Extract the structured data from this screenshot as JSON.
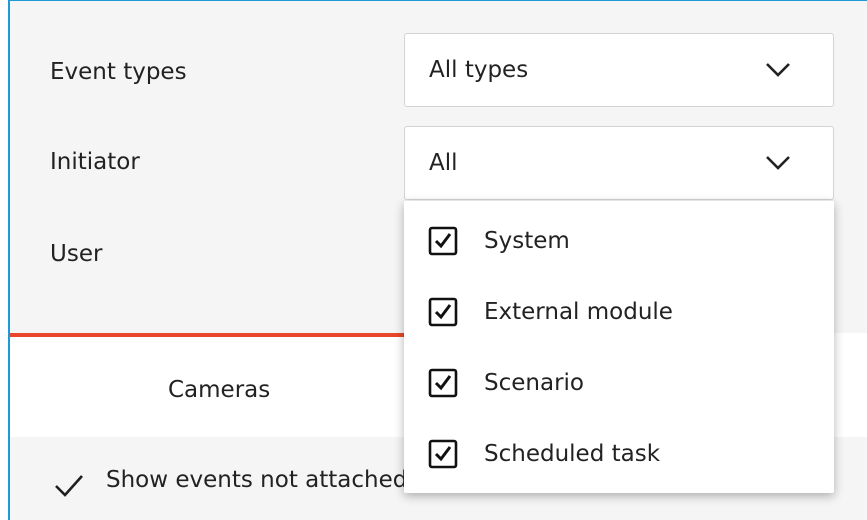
{
  "filters": {
    "event_types": {
      "label": "Event types",
      "value": "All types"
    },
    "initiator": {
      "label": "Initiator",
      "value": "All"
    },
    "user": {
      "label": "User"
    }
  },
  "initiator_dropdown": {
    "options": [
      {
        "label": "System",
        "checked": true
      },
      {
        "label": "External module",
        "checked": true
      },
      {
        "label": "Scenario",
        "checked": true
      },
      {
        "label": "Scheduled task",
        "checked": true
      }
    ]
  },
  "tabs": [
    {
      "label": "Cameras"
    }
  ],
  "show_unattached": {
    "label": "Show events not attached to cameras",
    "checked": true
  },
  "colors": {
    "accent": "#e8472a",
    "window_border": "#1e9bd7"
  },
  "icons": {
    "dropdown": "chevron-down-icon",
    "checkbox": "checkbox-checked-icon",
    "check": "check-icon"
  }
}
